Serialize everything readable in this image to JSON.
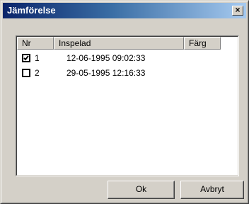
{
  "window": {
    "title": "Jämförelse",
    "close_symbol": "×"
  },
  "listview": {
    "columns": [
      "Nr",
      "Inspelad",
      "Färg"
    ],
    "rows": [
      {
        "nr": "1",
        "recorded": "12-06-1995 09:02:33",
        "checked": true
      },
      {
        "nr": "2",
        "recorded": "29-05-1995 12:16:33",
        "checked": false
      }
    ]
  },
  "buttons": {
    "ok": "Ok",
    "cancel": "Avbryt"
  }
}
